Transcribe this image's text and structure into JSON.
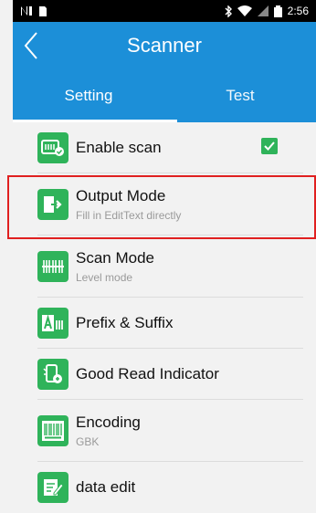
{
  "status_bar": {
    "time": "2:56"
  },
  "app_bar": {
    "title": "Scanner"
  },
  "tabs": [
    {
      "label": "Setting",
      "active": true
    },
    {
      "label": "Test",
      "active": false
    }
  ],
  "items": [
    {
      "label": "Enable scan",
      "subtitle": "",
      "icon": "enable-scan-icon",
      "checked": true
    },
    {
      "label": "Output Mode",
      "subtitle": "Fill in EditText directly",
      "icon": "output-mode-icon"
    },
    {
      "label": "Scan Mode",
      "subtitle": "Level mode",
      "icon": "scan-mode-icon"
    },
    {
      "label": "Prefix & Suffix",
      "subtitle": "",
      "icon": "prefix-suffix-icon"
    },
    {
      "label": "Good Read Indicator",
      "subtitle": "",
      "icon": "good-read-indicator-icon"
    },
    {
      "label": "Encoding",
      "subtitle": "GBK",
      "icon": "barcode-icon"
    },
    {
      "label": "data edit",
      "subtitle": "",
      "icon": "edit-icon"
    }
  ],
  "colors": {
    "accent": "#1c8fd8",
    "icon_green": "#2fb35a",
    "highlight": "#e02020"
  }
}
